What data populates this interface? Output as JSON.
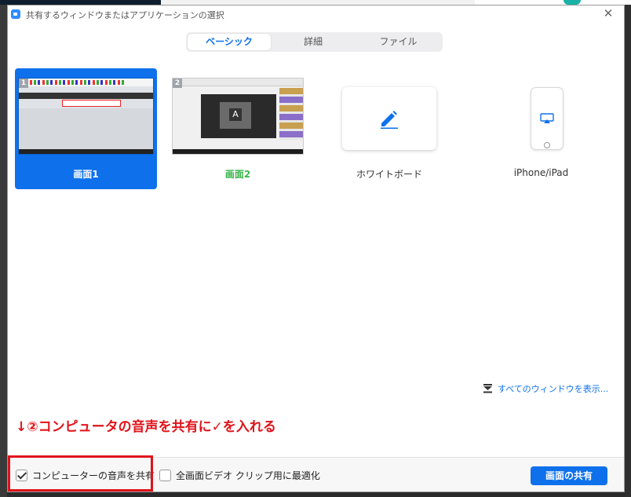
{
  "window": {
    "title": "共有するウィンドウまたはアプリケーションの選択",
    "app_icon": "zoom-camera-icon",
    "close_icon": "close-icon"
  },
  "tabs": [
    {
      "label": "ベーシック",
      "active": true
    },
    {
      "label": "詳細",
      "active": false
    },
    {
      "label": "ファイル",
      "active": false
    }
  ],
  "share_options": [
    {
      "label": "画面1",
      "badge": "1",
      "selected": true
    },
    {
      "label": "画面2",
      "badge": "2",
      "selected": false
    },
    {
      "label": "ホワイトボード",
      "icon": "pencil-icon",
      "selected": false
    },
    {
      "label": "iPhone/iPad",
      "icon": "airplay-icon",
      "selected": false
    }
  ],
  "thumb2_overlay_letter": "A",
  "all_windows_link": "すべてのウィンドウを表示...",
  "annotation": "↓②コンピュータの音声を共有に✓を入れる",
  "footer": {
    "share_audio": {
      "label": "コンピューターの音声を共有",
      "checked": true
    },
    "optimize_video": {
      "label": "全画面ビデオ クリップ用に最適化",
      "checked": false
    },
    "share_button": "画面の共有"
  },
  "colors": {
    "accent": "#0e71eb",
    "selected_green": "#39b54a",
    "annotation_red": "#e0131a"
  }
}
